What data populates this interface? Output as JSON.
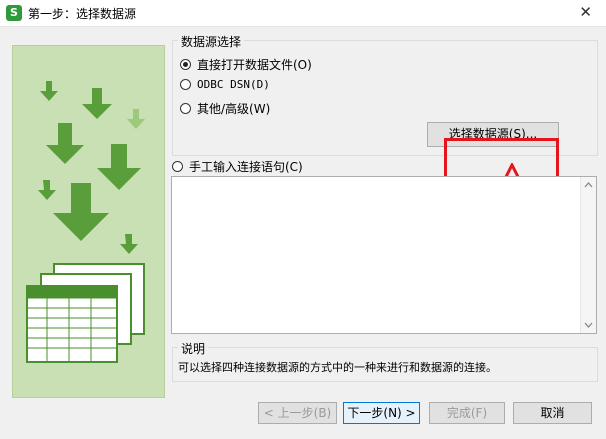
{
  "window": {
    "icon_text": "S",
    "title": "第一步：选择数据源",
    "close_glyph": "✕"
  },
  "datasource_group": {
    "legend": "数据源选择",
    "options": [
      {
        "label": "直接打开数据文件(O)",
        "selected": true
      },
      {
        "label": "ODBC DSN(D)",
        "selected": false
      },
      {
        "label": "其他/高级(W)",
        "selected": false
      }
    ],
    "select_button": "选择数据源(S)..."
  },
  "manual_option": {
    "label": "手工输入连接语句(C)",
    "selected": false
  },
  "connection_textarea": {
    "value": ""
  },
  "description": {
    "legend": "说明",
    "text": "可以选择四种连接数据源的方式中的一种来进行和数据源的连接。"
  },
  "footer": {
    "back_button": "< 上一步(B)",
    "next_button": "下一步(N) >",
    "finish_button": "完成(F)",
    "cancel_button": "取消"
  },
  "colors": {
    "annotation_red": "#e8141c",
    "arrow_green": "#5a9e3c",
    "arrow_light_green": "#9cc97c",
    "panel_green": "#c9dfb4"
  },
  "icons": [
    "wps-app-icon",
    "close-icon",
    "down-arrow-icon",
    "spreadsheet-stack-icon",
    "scroll-up-icon",
    "scroll-down-icon"
  ]
}
